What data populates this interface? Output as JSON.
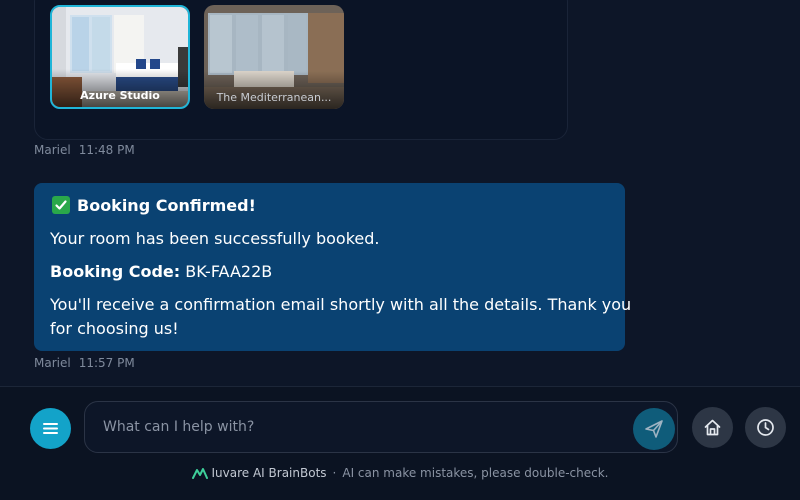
{
  "previous_message": {
    "rooms": [
      {
        "name": "Azure Studio",
        "selected": true
      },
      {
        "name": "The Mediterranean...",
        "selected": false
      }
    ],
    "author": "Mariel",
    "time": "11:48 PM"
  },
  "confirmation": {
    "title": "Booking Confirmed!",
    "body": "Your room has been successfully booked.",
    "code_label": "Booking Code:",
    "code_value": "BK-FAA22B",
    "note_line1": "You'll receive a confirmation email shortly with all the details. Thank you",
    "note_line2": "for choosing us!",
    "author": "Mariel",
    "time": "11:57 PM"
  },
  "composer": {
    "placeholder": "What can I help with?"
  },
  "icons": {
    "menu": "menu-icon",
    "send": "send-icon",
    "home": "home-icon",
    "history": "clock-icon",
    "check": "check-icon"
  },
  "footer": {
    "brand": "Iuvare AI BrainBots",
    "separator": "·",
    "disclaimer": "AI can make mistakes, please double-check."
  },
  "colors": {
    "background": "#0d1628",
    "bubble": "#0a4272",
    "accent": "#13a3c9",
    "check": "#2aa84a"
  }
}
